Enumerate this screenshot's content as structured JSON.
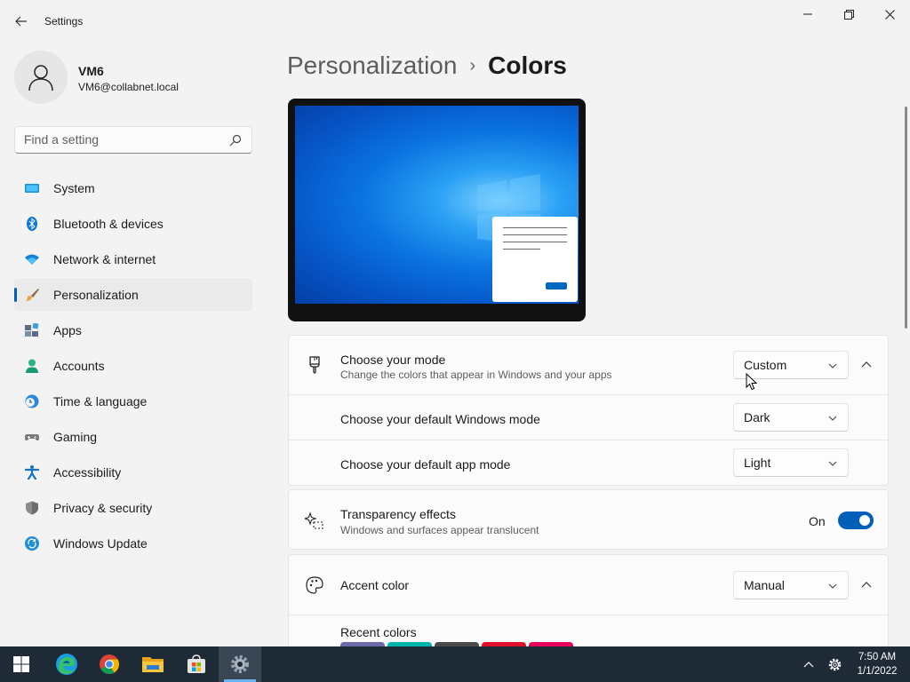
{
  "window": {
    "title": "Settings",
    "back_icon": "back-arrow-icon",
    "controls": [
      "minimize-icon",
      "maximize-icon",
      "close-icon"
    ]
  },
  "profile": {
    "name": "VM6",
    "email": "VM6@collabnet.local"
  },
  "search": {
    "placeholder": "Find a setting"
  },
  "sidebar": {
    "items": [
      {
        "label": "System",
        "icon": "system-icon",
        "active": false
      },
      {
        "label": "Bluetooth & devices",
        "icon": "bluetooth-icon",
        "active": false
      },
      {
        "label": "Network & internet",
        "icon": "wifi-icon",
        "active": false
      },
      {
        "label": "Personalization",
        "icon": "brush-icon",
        "active": true
      },
      {
        "label": "Apps",
        "icon": "apps-icon",
        "active": false
      },
      {
        "label": "Accounts",
        "icon": "accounts-icon",
        "active": false
      },
      {
        "label": "Time & language",
        "icon": "clock-globe-icon",
        "active": false
      },
      {
        "label": "Gaming",
        "icon": "gamepad-icon",
        "active": false
      },
      {
        "label": "Accessibility",
        "icon": "accessibility-icon",
        "active": false
      },
      {
        "label": "Privacy & security",
        "icon": "shield-icon",
        "active": false
      },
      {
        "label": "Windows Update",
        "icon": "update-icon",
        "active": false
      }
    ]
  },
  "breadcrumb": {
    "parent": "Personalization",
    "separator": "›",
    "current": "Colors"
  },
  "mode_card": {
    "title": "Choose your mode",
    "subtitle": "Change the colors that appear in Windows and your apps",
    "value": "Custom",
    "icon": "paintbrush-icon"
  },
  "windows_mode": {
    "title": "Choose your default Windows mode",
    "value": "Dark"
  },
  "app_mode": {
    "title": "Choose your default app mode",
    "value": "Light"
  },
  "transparency": {
    "title": "Transparency effects",
    "subtitle": "Windows and surfaces appear translucent",
    "state": "On",
    "icon": "sparkle-icon"
  },
  "accent": {
    "title": "Accent color",
    "value": "Manual",
    "icon": "palette-icon",
    "recent_label": "Recent colors",
    "recent_colors": [
      "#6b69a8",
      "#00b4aa",
      "#4a4a4a",
      "#e0102a",
      "#e8005a"
    ]
  },
  "colors": {
    "accent": "#005fb8",
    "taskbar": "#1f2a37"
  },
  "taskbar": {
    "items": [
      "start-icon",
      "edge-icon",
      "chrome-icon",
      "file-explorer-icon",
      "store-icon",
      "settings-icon"
    ],
    "time": "7:50 AM",
    "date": "1/1/2022"
  }
}
